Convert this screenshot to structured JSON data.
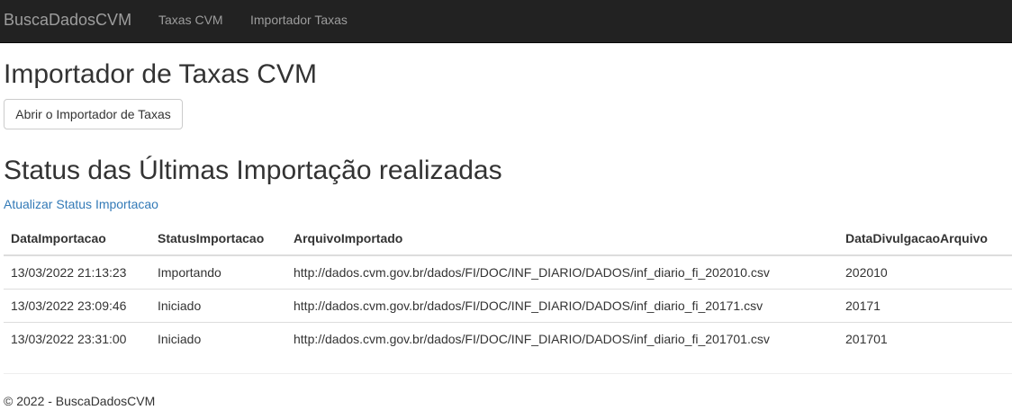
{
  "navbar": {
    "brand": "BuscaDadosCVM",
    "links": [
      "Taxas CVM",
      "Importador Taxas"
    ]
  },
  "main": {
    "title": "Importador de Taxas CVM",
    "open_button": "Abrir o Importador de Taxas",
    "status_title": "Status das Últimas Importação realizadas",
    "refresh_link": "Atualizar Status Importacao"
  },
  "table": {
    "headers": [
      "DataImportacao",
      "StatusImportacao",
      "ArquivoImportado",
      "DataDivulgacaoArquivo"
    ],
    "rows": [
      [
        "13/03/2022 21:13:23",
        "Importando",
        "http://dados.cvm.gov.br/dados/FI/DOC/INF_DIARIO/DADOS/inf_diario_fi_202010.csv",
        "202010"
      ],
      [
        "13/03/2022 23:09:46",
        "Iniciado",
        "http://dados.cvm.gov.br/dados/FI/DOC/INF_DIARIO/DADOS/inf_diario_fi_20171.csv",
        "20171"
      ],
      [
        "13/03/2022 23:31:00",
        "Iniciado",
        "http://dados.cvm.gov.br/dados/FI/DOC/INF_DIARIO/DADOS/inf_diario_fi_201701.csv",
        "201701"
      ]
    ]
  },
  "footer": {
    "text": "© 2022 - BuscaDadosCVM"
  },
  "colors": {
    "navbar_bg": "#222222",
    "nav_text": "#9d9d9d",
    "link": "#337ab7",
    "border": "#dddddd"
  }
}
